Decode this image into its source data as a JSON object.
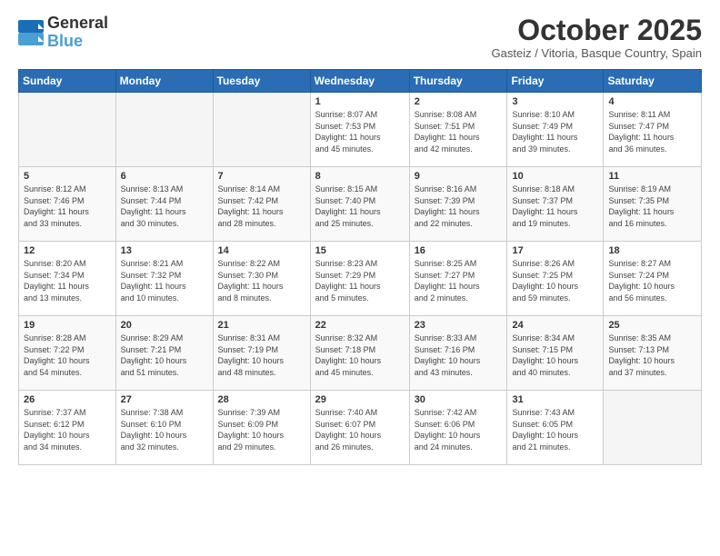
{
  "logo": {
    "line1": "General",
    "line2": "Blue"
  },
  "title": "October 2025",
  "location": "Gasteiz / Vitoria, Basque Country, Spain",
  "days_header": [
    "Sunday",
    "Monday",
    "Tuesday",
    "Wednesday",
    "Thursday",
    "Friday",
    "Saturday"
  ],
  "weeks": [
    [
      {
        "num": "",
        "info": ""
      },
      {
        "num": "",
        "info": ""
      },
      {
        "num": "",
        "info": ""
      },
      {
        "num": "1",
        "info": "Sunrise: 8:07 AM\nSunset: 7:53 PM\nDaylight: 11 hours\nand 45 minutes."
      },
      {
        "num": "2",
        "info": "Sunrise: 8:08 AM\nSunset: 7:51 PM\nDaylight: 11 hours\nand 42 minutes."
      },
      {
        "num": "3",
        "info": "Sunrise: 8:10 AM\nSunset: 7:49 PM\nDaylight: 11 hours\nand 39 minutes."
      },
      {
        "num": "4",
        "info": "Sunrise: 8:11 AM\nSunset: 7:47 PM\nDaylight: 11 hours\nand 36 minutes."
      }
    ],
    [
      {
        "num": "5",
        "info": "Sunrise: 8:12 AM\nSunset: 7:46 PM\nDaylight: 11 hours\nand 33 minutes."
      },
      {
        "num": "6",
        "info": "Sunrise: 8:13 AM\nSunset: 7:44 PM\nDaylight: 11 hours\nand 30 minutes."
      },
      {
        "num": "7",
        "info": "Sunrise: 8:14 AM\nSunset: 7:42 PM\nDaylight: 11 hours\nand 28 minutes."
      },
      {
        "num": "8",
        "info": "Sunrise: 8:15 AM\nSunset: 7:40 PM\nDaylight: 11 hours\nand 25 minutes."
      },
      {
        "num": "9",
        "info": "Sunrise: 8:16 AM\nSunset: 7:39 PM\nDaylight: 11 hours\nand 22 minutes."
      },
      {
        "num": "10",
        "info": "Sunrise: 8:18 AM\nSunset: 7:37 PM\nDaylight: 11 hours\nand 19 minutes."
      },
      {
        "num": "11",
        "info": "Sunrise: 8:19 AM\nSunset: 7:35 PM\nDaylight: 11 hours\nand 16 minutes."
      }
    ],
    [
      {
        "num": "12",
        "info": "Sunrise: 8:20 AM\nSunset: 7:34 PM\nDaylight: 11 hours\nand 13 minutes."
      },
      {
        "num": "13",
        "info": "Sunrise: 8:21 AM\nSunset: 7:32 PM\nDaylight: 11 hours\nand 10 minutes."
      },
      {
        "num": "14",
        "info": "Sunrise: 8:22 AM\nSunset: 7:30 PM\nDaylight: 11 hours\nand 8 minutes."
      },
      {
        "num": "15",
        "info": "Sunrise: 8:23 AM\nSunset: 7:29 PM\nDaylight: 11 hours\nand 5 minutes."
      },
      {
        "num": "16",
        "info": "Sunrise: 8:25 AM\nSunset: 7:27 PM\nDaylight: 11 hours\nand 2 minutes."
      },
      {
        "num": "17",
        "info": "Sunrise: 8:26 AM\nSunset: 7:25 PM\nDaylight: 10 hours\nand 59 minutes."
      },
      {
        "num": "18",
        "info": "Sunrise: 8:27 AM\nSunset: 7:24 PM\nDaylight: 10 hours\nand 56 minutes."
      }
    ],
    [
      {
        "num": "19",
        "info": "Sunrise: 8:28 AM\nSunset: 7:22 PM\nDaylight: 10 hours\nand 54 minutes."
      },
      {
        "num": "20",
        "info": "Sunrise: 8:29 AM\nSunset: 7:21 PM\nDaylight: 10 hours\nand 51 minutes."
      },
      {
        "num": "21",
        "info": "Sunrise: 8:31 AM\nSunset: 7:19 PM\nDaylight: 10 hours\nand 48 minutes."
      },
      {
        "num": "22",
        "info": "Sunrise: 8:32 AM\nSunset: 7:18 PM\nDaylight: 10 hours\nand 45 minutes."
      },
      {
        "num": "23",
        "info": "Sunrise: 8:33 AM\nSunset: 7:16 PM\nDaylight: 10 hours\nand 43 minutes."
      },
      {
        "num": "24",
        "info": "Sunrise: 8:34 AM\nSunset: 7:15 PM\nDaylight: 10 hours\nand 40 minutes."
      },
      {
        "num": "25",
        "info": "Sunrise: 8:35 AM\nSunset: 7:13 PM\nDaylight: 10 hours\nand 37 minutes."
      }
    ],
    [
      {
        "num": "26",
        "info": "Sunrise: 7:37 AM\nSunset: 6:12 PM\nDaylight: 10 hours\nand 34 minutes."
      },
      {
        "num": "27",
        "info": "Sunrise: 7:38 AM\nSunset: 6:10 PM\nDaylight: 10 hours\nand 32 minutes."
      },
      {
        "num": "28",
        "info": "Sunrise: 7:39 AM\nSunset: 6:09 PM\nDaylight: 10 hours\nand 29 minutes."
      },
      {
        "num": "29",
        "info": "Sunrise: 7:40 AM\nSunset: 6:07 PM\nDaylight: 10 hours\nand 26 minutes."
      },
      {
        "num": "30",
        "info": "Sunrise: 7:42 AM\nSunset: 6:06 PM\nDaylight: 10 hours\nand 24 minutes."
      },
      {
        "num": "31",
        "info": "Sunrise: 7:43 AM\nSunset: 6:05 PM\nDaylight: 10 hours\nand 21 minutes."
      },
      {
        "num": "",
        "info": ""
      }
    ]
  ]
}
